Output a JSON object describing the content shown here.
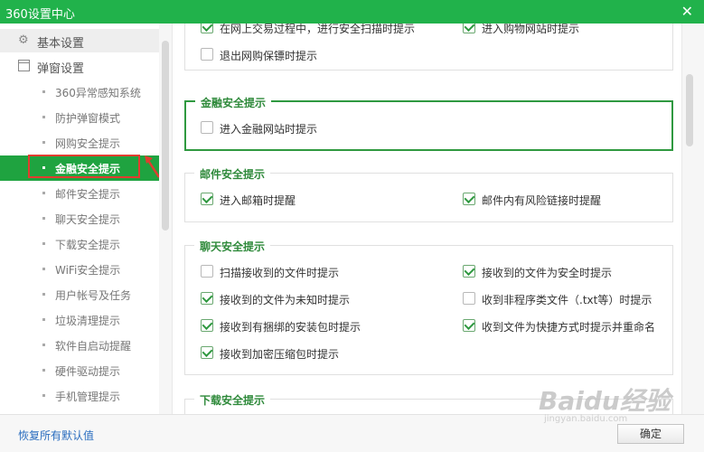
{
  "window": {
    "title": "360设置中心",
    "close_glyph": "✕"
  },
  "sidebar": {
    "categories": [
      {
        "label": "基本设置",
        "icon": "gear-icon"
      },
      {
        "label": "弹窗设置",
        "icon": "window-icon"
      }
    ],
    "items": [
      {
        "label": "360异常感知系统"
      },
      {
        "label": "防护弹窗模式"
      },
      {
        "label": "网购安全提示"
      },
      {
        "label": "金融安全提示"
      },
      {
        "label": "邮件安全提示"
      },
      {
        "label": "聊天安全提示"
      },
      {
        "label": "下载安全提示"
      },
      {
        "label": "WiFi安全提示"
      },
      {
        "label": "用户帐号及任务"
      },
      {
        "label": "垃圾清理提示"
      },
      {
        "label": "软件自启动提醒"
      },
      {
        "label": "硬件驱动提示"
      },
      {
        "label": "手机管理提示"
      }
    ],
    "active_index": 3
  },
  "content": {
    "top_partial": {
      "items": [
        {
          "label": "在网上交易过程中，进行安全扫描时提示",
          "checked": true
        },
        {
          "label": "进入购物网站时提示",
          "checked": true
        },
        {
          "label": "退出网购保镖时提示",
          "checked": false
        }
      ]
    },
    "finance": {
      "title": "金融安全提示",
      "items": [
        {
          "label": "进入金融网站时提示",
          "checked": false
        }
      ]
    },
    "mail": {
      "title": "邮件安全提示",
      "items": [
        {
          "label": "进入邮箱时提醒",
          "checked": true
        },
        {
          "label": "邮件内有风险链接时提醒",
          "checked": true
        }
      ]
    },
    "chat": {
      "title": "聊天安全提示",
      "items": [
        {
          "label": "扫描接收到的文件时提示",
          "checked": false
        },
        {
          "label": "接收到的文件为安全时提示",
          "checked": true
        },
        {
          "label": "接收到的文件为未知时提示",
          "checked": true
        },
        {
          "label": "收到非程序类文件（.txt等）时提示",
          "checked": false
        },
        {
          "label": "接收到有捆绑的安装包时提示",
          "checked": true
        },
        {
          "label": "收到文件为快捷方式时提示并重命名",
          "checked": true
        },
        {
          "label": "接收到加密压缩包时提示",
          "checked": true
        }
      ]
    },
    "download": {
      "title": "下载安全提示"
    }
  },
  "footer": {
    "reset_label": "恢复所有默认值",
    "ok_label": "确定"
  },
  "watermark": {
    "text": "Baidu经验",
    "sub": "jingyan.baidu.com"
  },
  "colors": {
    "accent": "#21b24b",
    "active_item": "#1fa340",
    "group_title": "#2f8a3b",
    "highlight_box": "#e23c2f"
  }
}
